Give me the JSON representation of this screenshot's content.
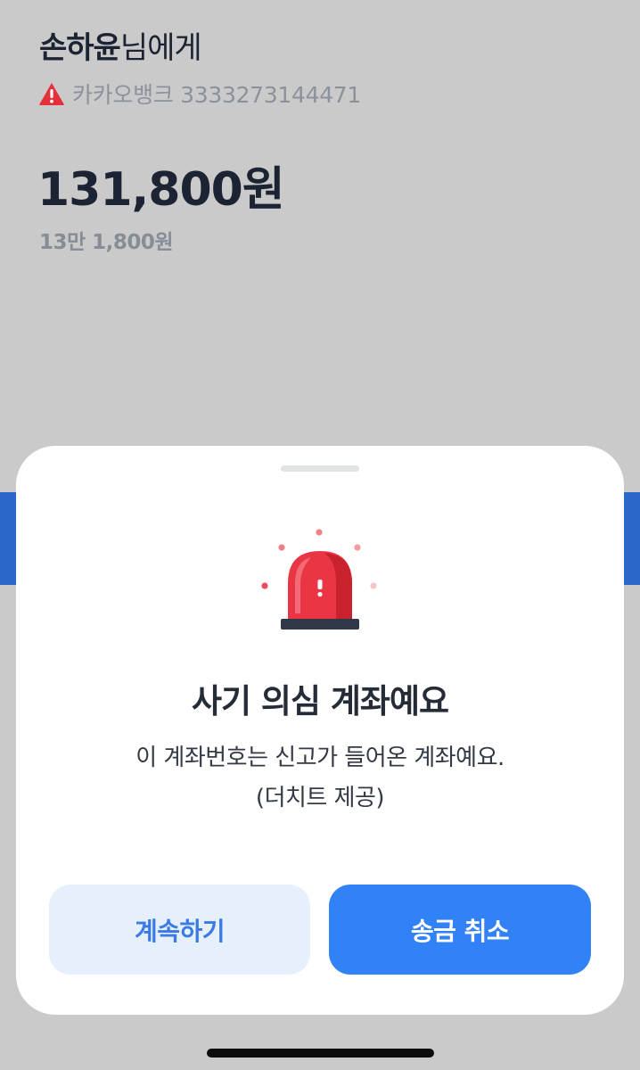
{
  "recipient": {
    "name": "손하윤",
    "suffix": "님에게"
  },
  "account": {
    "warning_icon": "warning-triangle-icon",
    "text": "카카오뱅크 3333273144471"
  },
  "amount": {
    "value": "131,800원",
    "korean": "13만 1,800원"
  },
  "alert_sheet": {
    "icon": "siren-icon",
    "title": "사기 의심 계좌예요",
    "description_line1": "이 계좌번호는 신고가 들어온 계좌예요.",
    "description_line2": "(더치트 제공)",
    "continue_label": "계속하기",
    "cancel_label": "송금 취소"
  },
  "colors": {
    "background_dim": "#cacaca",
    "warning_red": "#e5303c",
    "primary_blue": "#3182f6",
    "secondary_button_bg": "#e6f0fd"
  }
}
